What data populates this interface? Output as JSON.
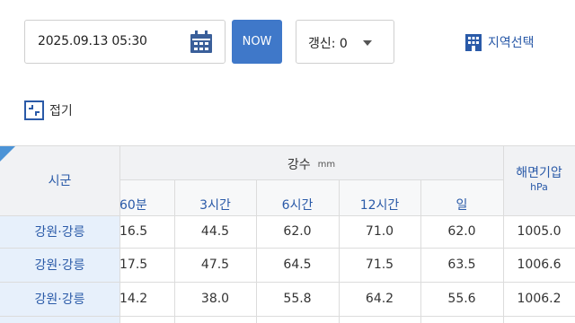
{
  "toolbar": {
    "datetime_value": "2025.09.13 05:30",
    "now_label": "NOW",
    "refresh_label": "갱신: 0",
    "region_select_label": "지역선택"
  },
  "fold": {
    "label": "접기"
  },
  "table": {
    "region_header": "시군",
    "rain_header": "강수",
    "rain_unit": "mm",
    "rain_columns": [
      "60분",
      "3시간",
      "6시간",
      "12시간",
      "일"
    ],
    "pressure_header": "해면기압",
    "pressure_unit": "hPa",
    "rows": [
      {
        "region": "강원·강릉",
        "min60": "16.5",
        "h3": "44.5",
        "h6": "62.0",
        "h12": "71.0",
        "day": "62.0",
        "pressure": "1005.0"
      },
      {
        "region": "강원·강릉",
        "min60": "17.5",
        "h3": "47.5",
        "h6": "64.5",
        "h12": "71.5",
        "day": "63.5",
        "pressure": "1006.6"
      },
      {
        "region": "강원·강릉",
        "min60": "14.2",
        "h3": "38.0",
        "h6": "55.8",
        "h12": "64.2",
        "day": "55.6",
        "pressure": "1006.2"
      }
    ]
  },
  "colors": {
    "accent": "#3f78c9",
    "header_bg": "#f1f2f4",
    "region_bg": "#e7f0fb",
    "link": "#2a5aa8"
  },
  "icons": {
    "calendar": "calendar-icon",
    "building": "building-icon",
    "fold": "fold-icon",
    "caret": "chevron-down-icon"
  }
}
